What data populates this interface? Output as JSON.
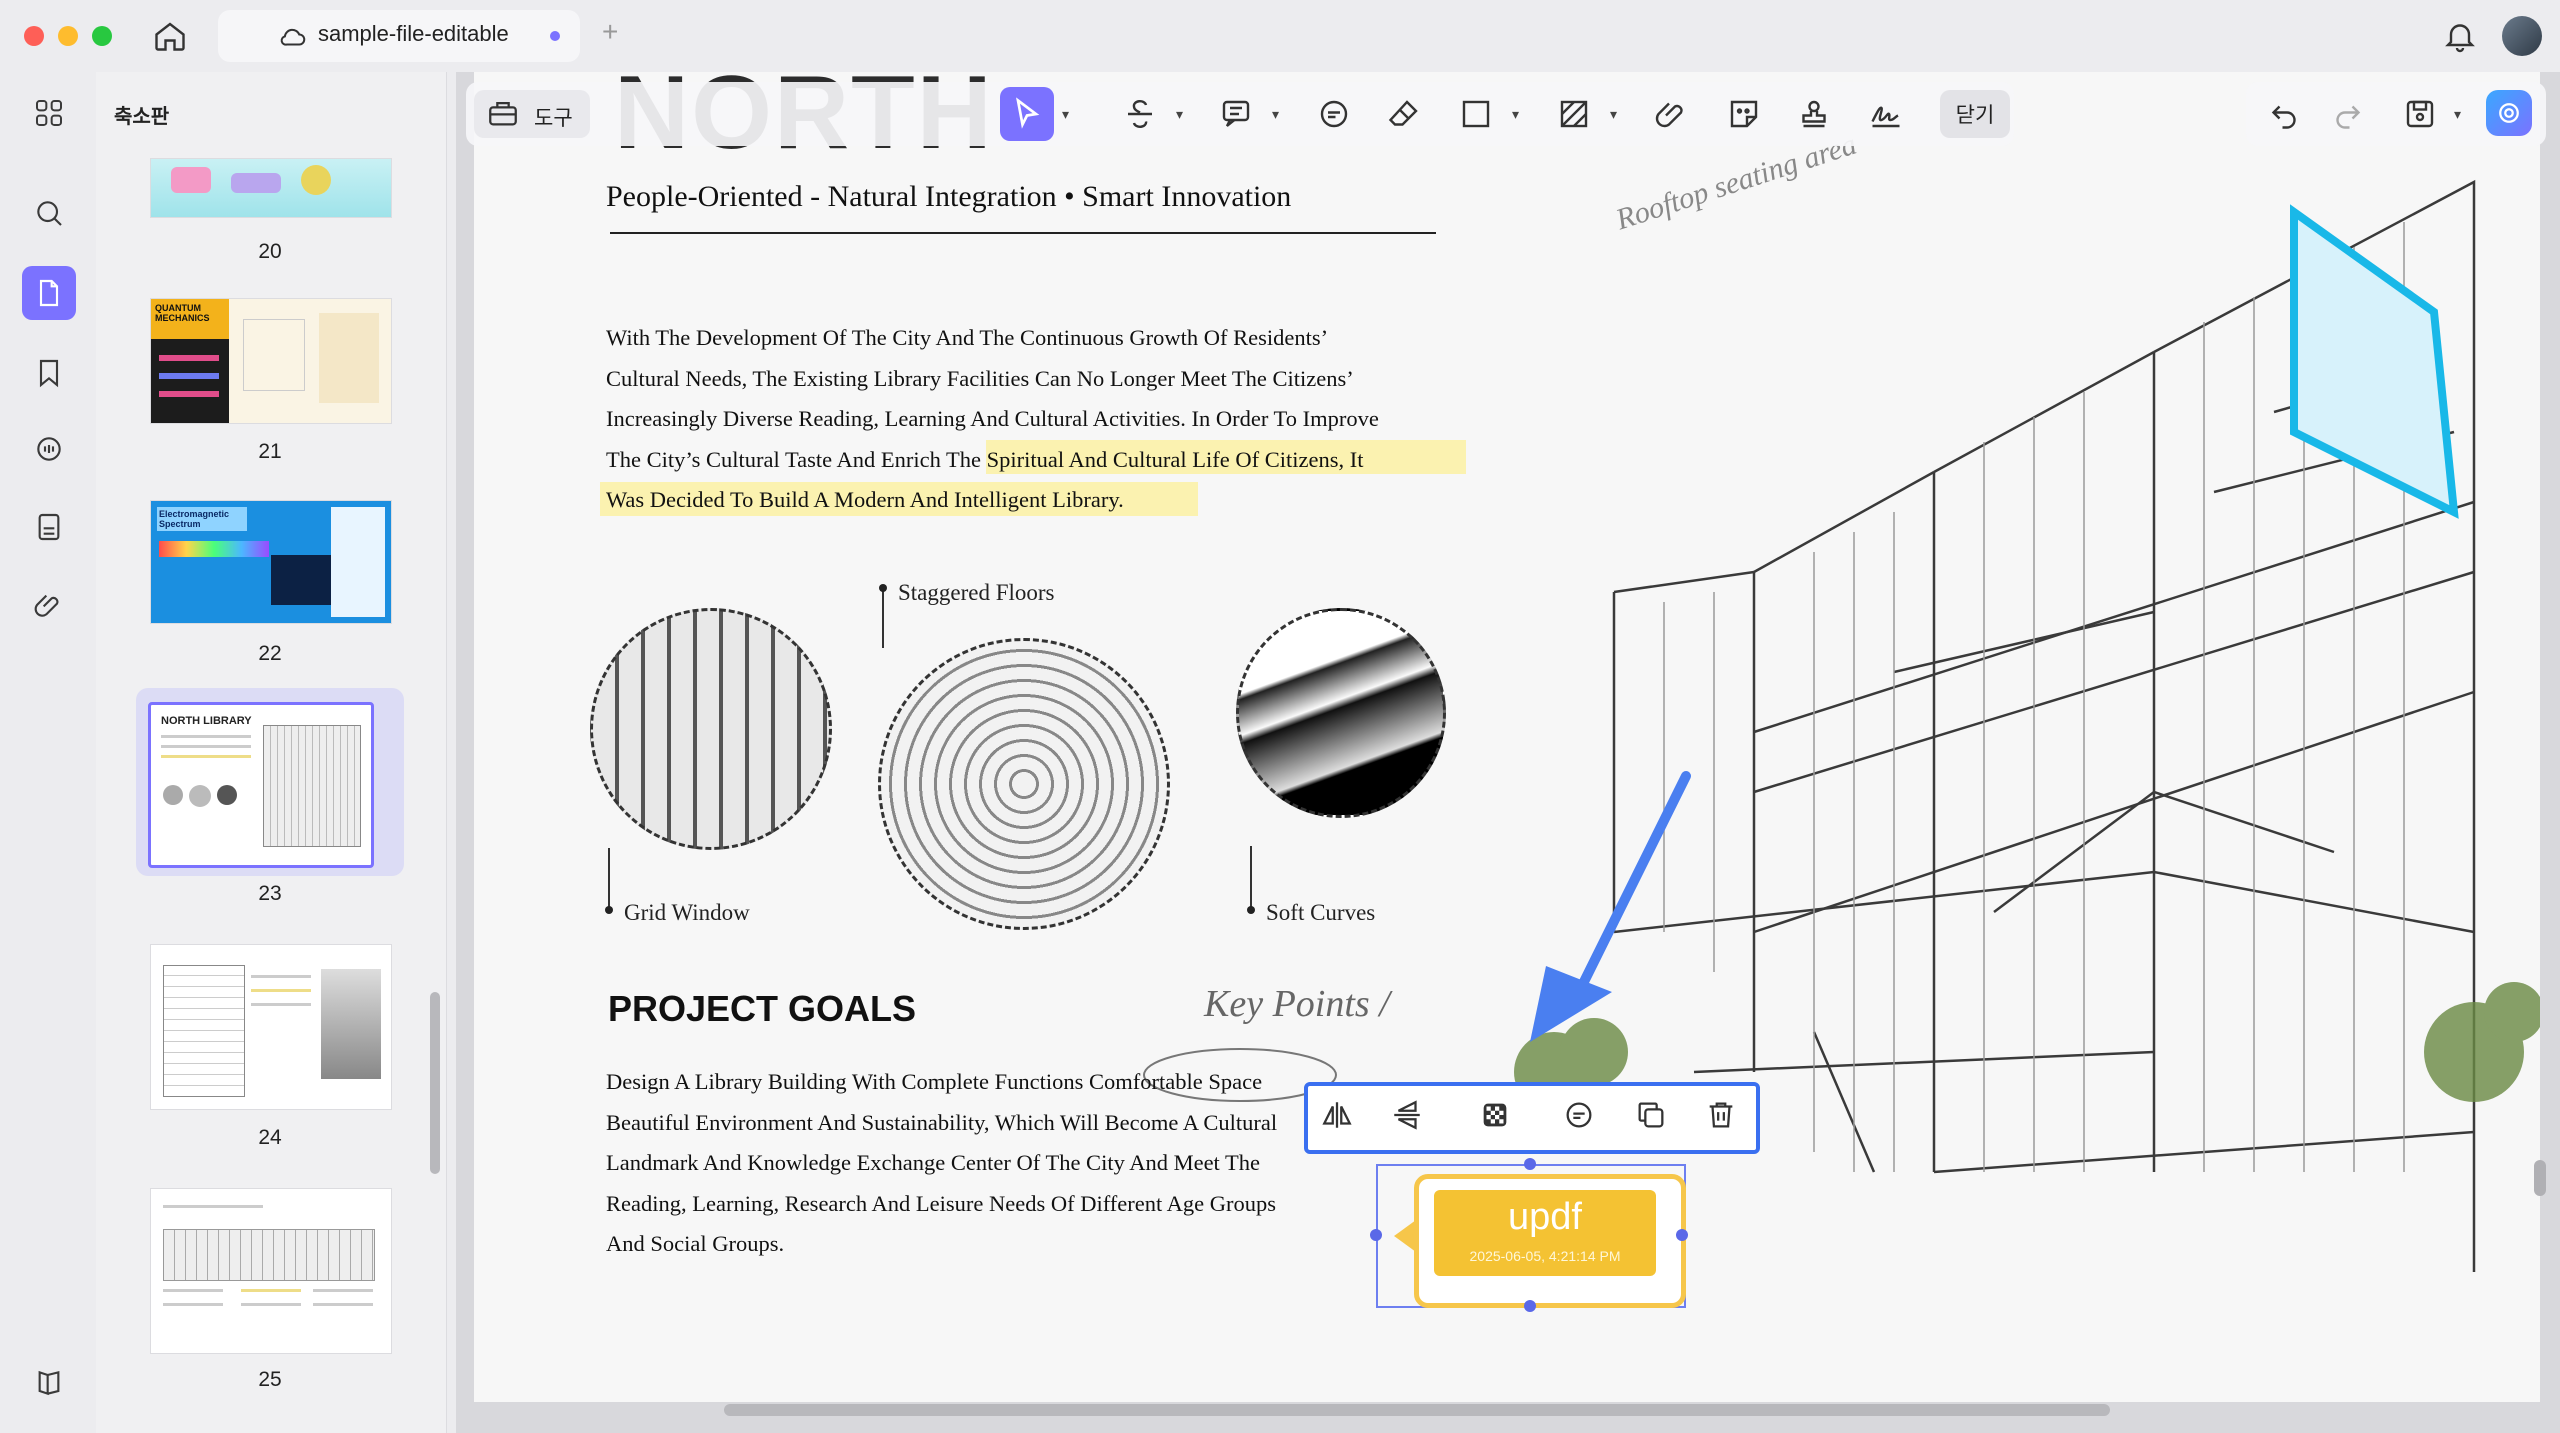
{
  "window": {
    "tab_title": "sample-file-editable"
  },
  "sidebar": {
    "panel_title": "축소판",
    "thumbnails": [
      {
        "page": "20"
      },
      {
        "page": "21",
        "label": "QUANTUM MECHANICS"
      },
      {
        "page": "22",
        "label": "Electromagnetic Spectrum"
      },
      {
        "page": "23",
        "label": "NORTH LIBRARY",
        "selected": true
      },
      {
        "page": "24"
      },
      {
        "page": "25"
      }
    ]
  },
  "toolbar": {
    "tools_label": "도구",
    "close_label": "닫기",
    "accent_color": "#7b72ff"
  },
  "page": {
    "title": "NORTH",
    "subtitle": "People-Oriented - Natural Integration • Smart Innovation",
    "intro_lines": [
      "With The Development Of The City And The Continuous Growth Of Residents’",
      "Cultural Needs, The Existing Library Facilities Can No Longer Meet The Citizens’",
      "Increasingly Diverse Reading, Learning And Cultural Activities. In Order To Improve",
      "The City’s Cultural Taste And Enrich The Spiritual And Cultural Life Of Citizens, It",
      "Was Decided To Build A Modern And Intelligent Library."
    ],
    "captions": {
      "staggered": "Staggered Floors",
      "grid": "Grid Window",
      "curves": "Soft Curves"
    },
    "goals_title": "PROJECT GOALS",
    "goals_lines": [
      "Design A Library Building With Complete Functions Comfortable Space",
      "Beautiful Environment And Sustainability, Which Will Become A Cultural",
      "Landmark And Knowledge Exchange Center Of The City And Meet The",
      "Reading, Learning, Research And Leisure Needs Of Different Age Groups",
      "And Social Groups."
    ],
    "sketch_note_1": "Rooftop seating area",
    "sketch_note_2": "Key Points /"
  },
  "stamp": {
    "title": "updf",
    "date": "2025-06-05, 4:21:14 PM",
    "color": "#f4c233"
  },
  "selection_color": "#3a6ff0"
}
